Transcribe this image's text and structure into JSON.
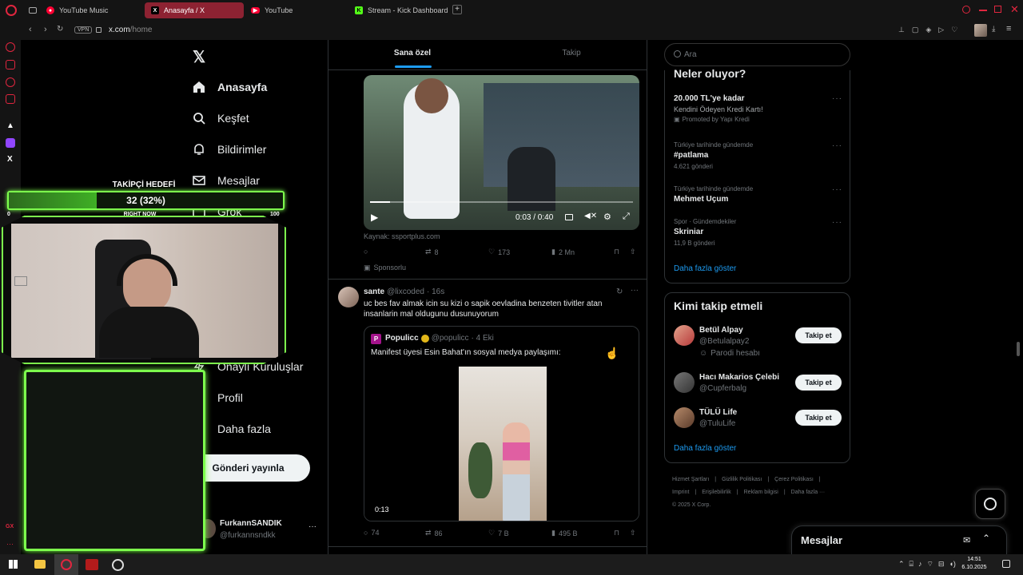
{
  "browser": {
    "tabs": [
      {
        "label": "YouTube Music",
        "icon": "youtube-music-icon",
        "color": "#ff0033"
      },
      {
        "label": "Anasayfa / X",
        "icon": "x-icon",
        "color": "#000000"
      },
      {
        "label": "YouTube",
        "icon": "youtube-icon",
        "color": "#ff0033"
      },
      {
        "label": "Stream - Kick Dashboard",
        "icon": "kick-icon",
        "color": "#53fc18"
      }
    ],
    "url_host": "x.com",
    "url_path": "/home",
    "vpn": "VPN"
  },
  "nav": {
    "items": [
      {
        "label": "Anasayfa",
        "icon": "home-icon"
      },
      {
        "label": "Keşfet",
        "icon": "search-icon"
      },
      {
        "label": "Bildirimler",
        "icon": "bell-icon"
      },
      {
        "label": "Mesajlar",
        "icon": "mail-icon"
      },
      {
        "label": "Grok",
        "icon": "grok-icon"
      },
      {
        "label": "Onaylı Kuruluşlar",
        "icon": "lightning-icon"
      },
      {
        "label": "Profil",
        "icon": "person-icon"
      },
      {
        "label": "Daha fazla",
        "icon": "more-circle-icon"
      }
    ],
    "post_button": "Gönderi yayınla",
    "account_name": "FurkannSANDIK",
    "account_handle": "@furkannsndkk"
  },
  "overlay": {
    "follower_title": "TAKİPÇİ HEDEFİ",
    "follower_value": "32 (32%)",
    "follower_progress": 0.32,
    "right_now": "RIGHT NOW",
    "min": "0",
    "max": "100",
    "accent": "#7dff4d"
  },
  "feed": {
    "tabs": [
      "Sana özel",
      "Takip"
    ],
    "ad": {
      "time": "0:03 / 0:40",
      "source": "Kaynak: ssportplus.com",
      "retweets": "8",
      "likes": "173",
      "views": "2 Mn",
      "sponsored": "Sponsorlu"
    },
    "post": {
      "name": "sante",
      "handle": "@lixcoded",
      "time": "· 16s",
      "text": "uc bes fav almak icin su kizi o sapik oevladina benzeten tivitler atan insanlarin mal oldugunu dusunuyorum",
      "quote_name": "Populicc",
      "quote_handle": "@populicc",
      "quote_time": "· 4 Eki",
      "quote_text": "Manifest üyesi Esin Bahat'ın sosyal medya paylaşımı:",
      "video_time": "0:13",
      "replies": "74",
      "retweets": "86",
      "likes": "7 B",
      "views": "495 B"
    }
  },
  "right": {
    "search_placeholder": "Ara",
    "trends_title": "Neler oluyor?",
    "trends": [
      {
        "meta": "",
        "title": "20.000 TL'ye kadar",
        "sub": "Kendini Ödeyen Kredi Kartı!",
        "extra": "Promoted by Yapı Kredi"
      },
      {
        "meta": "Türkiye tarihinde gündemde",
        "title": "#patlama",
        "sub": "",
        "extra": "4.621 gönderi"
      },
      {
        "meta": "Türkiye tarihinde gündemde",
        "title": "Mehmet Uçum",
        "sub": "",
        "extra": ""
      },
      {
        "meta": "Spor · Gündemdekiler",
        "title": "Skriniar",
        "sub": "",
        "extra": "11,9 B gönderi"
      }
    ],
    "show_more": "Daha fazla göster",
    "who_title": "Kimi takip etmeli",
    "who": [
      {
        "name": "Betül Alpay",
        "handle": "@Betulalpay2",
        "badge": "Parodi hesabı"
      },
      {
        "name": "Hacı Makarios Çelebi",
        "handle": "@Cupferbalg",
        "badge": ""
      },
      {
        "name": "TÜLÜ Life",
        "handle": "@TuluLife",
        "badge": ""
      }
    ],
    "follow_label": "Takip et",
    "footer": [
      "Hizmet Şartları",
      "Gizlilik Politikası",
      "Çerez Politikası",
      "Imprint",
      "Erişilebilirlik",
      "Reklam bilgisi",
      "Daha fazla ···",
      "© 2025 X Corp."
    ],
    "messages": "Mesajlar"
  },
  "taskbar": {
    "time": "14:51",
    "date": "6.10.2025"
  }
}
